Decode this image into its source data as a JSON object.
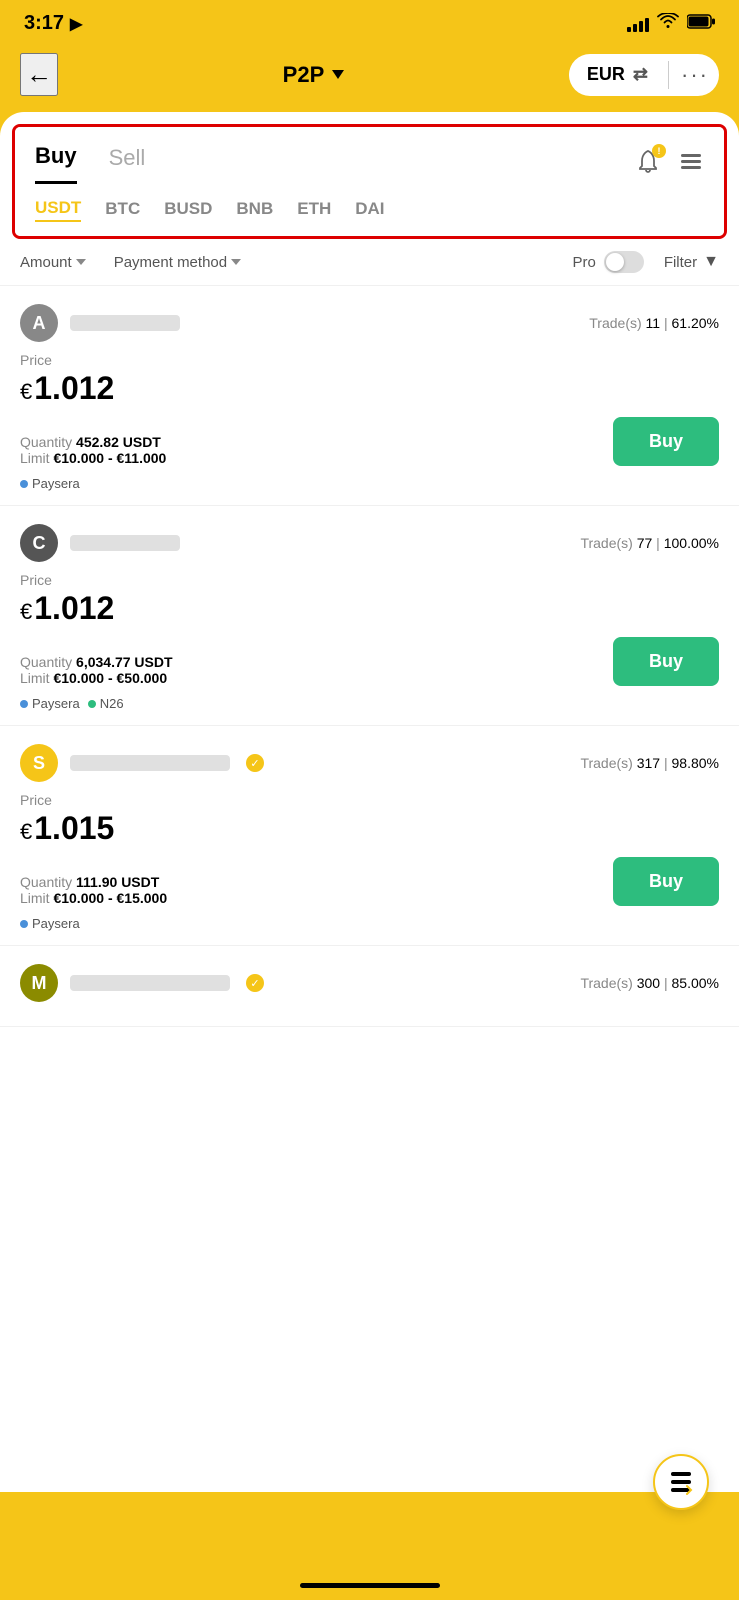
{
  "statusBar": {
    "time": "3:17",
    "locationIcon": "▶"
  },
  "header": {
    "backLabel": "←",
    "title": "P2P",
    "currencyLabel": "EUR",
    "swapIcon": "⇄",
    "moreIcon": "···"
  },
  "buyTab": "Buy",
  "sellTab": "Sell",
  "cryptoTabs": [
    "USDT",
    "BTC",
    "BUSD",
    "BNB",
    "ETH",
    "DAI"
  ],
  "activeCryptoTab": "USDT",
  "filters": {
    "amount": "Amount",
    "paymentMethod": "Payment method",
    "pro": "Pro",
    "filter": "Filter"
  },
  "trades": [
    {
      "avatarLetter": "A",
      "avatarColor": "gray",
      "tradesCount": "11",
      "successRate": "61.20%",
      "price": "1.012",
      "quantity": "452.82 USDT",
      "limitMin": "€10.000",
      "limitMax": "€11.000",
      "payments": [
        "Paysera"
      ],
      "verified": false
    },
    {
      "avatarLetter": "C",
      "avatarColor": "darkgray",
      "tradesCount": "77",
      "successRate": "100.00%",
      "price": "1.012",
      "quantity": "6,034.77 USDT",
      "limitMin": "€10.000",
      "limitMax": "€50.000",
      "payments": [
        "Paysera",
        "N26"
      ],
      "verified": false
    },
    {
      "avatarLetter": "S",
      "avatarColor": "gold",
      "tradesCount": "317",
      "successRate": "98.80%",
      "price": "1.015",
      "quantity": "111.90 USDT",
      "limitMin": "€10.000",
      "limitMax": "€15.000",
      "payments": [
        "Paysera"
      ],
      "verified": true
    },
    {
      "avatarLetter": "M",
      "avatarColor": "olive",
      "tradesCount": "300",
      "successRate": "85.00%",
      "price": "",
      "quantity": "",
      "limitMin": "",
      "limitMax": "",
      "payments": [],
      "verified": true,
      "partial": true
    }
  ],
  "buyButtonLabel": "Buy",
  "labels": {
    "price": "Price",
    "quantity": "Quantity",
    "limit": "Limit",
    "trades": "Trade(s)",
    "currencySymbol": "€"
  }
}
